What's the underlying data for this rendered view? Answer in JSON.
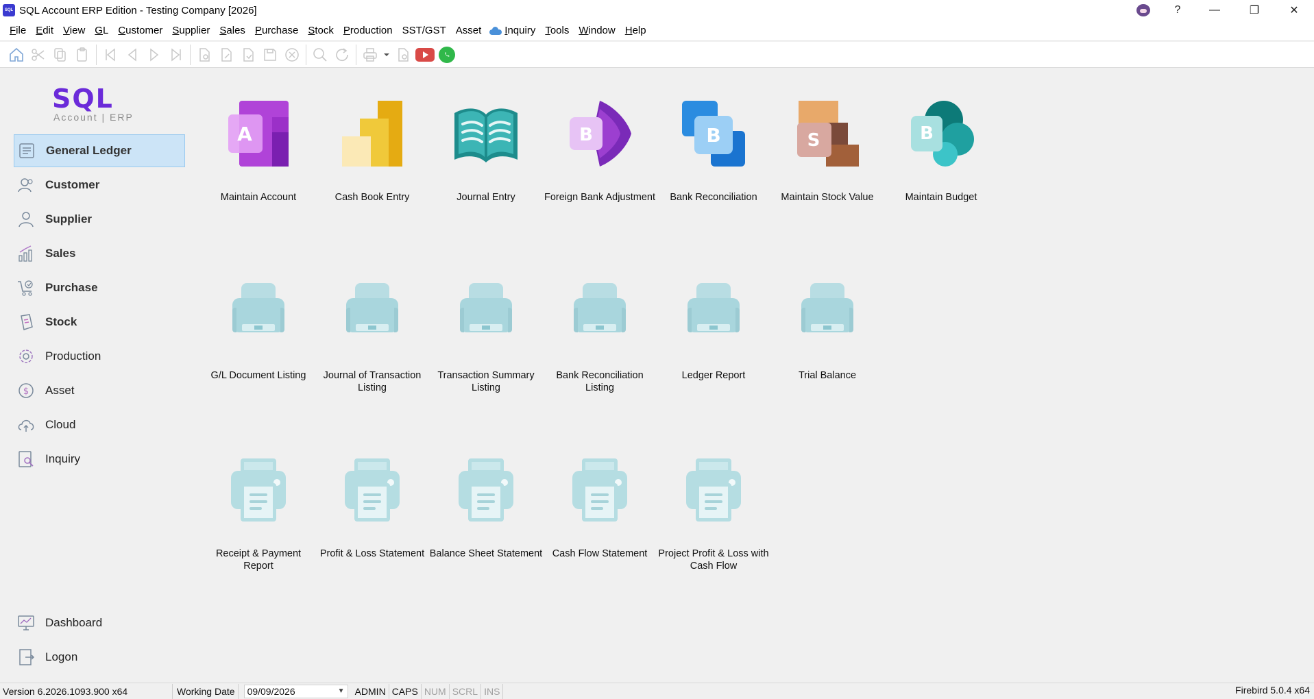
{
  "window": {
    "title": "SQL Account ERP Edition - Testing Company [2026]",
    "logo_text": "SQL",
    "help_label": "?",
    "minimize_label": "—",
    "maximize_label": "❐",
    "close_label": "✕"
  },
  "menu": [
    {
      "label": "File",
      "accel": "F",
      "rest": "ile"
    },
    {
      "label": "Edit",
      "accel": "E",
      "rest": "dit"
    },
    {
      "label": "View",
      "accel": "V",
      "rest": "iew"
    },
    {
      "label": "GL",
      "accel": "G",
      "rest": "L"
    },
    {
      "label": "Customer",
      "accel": "C",
      "rest": "ustomer"
    },
    {
      "label": "Supplier",
      "accel": "S",
      "rest": "upplier"
    },
    {
      "label": "Sales",
      "accel": "S",
      "rest": "ales"
    },
    {
      "label": "Purchase",
      "accel": "P",
      "rest": "urchase"
    },
    {
      "label": "Stock",
      "accel": "S",
      "rest": "tock"
    },
    {
      "label": "Production",
      "accel": "P",
      "rest": "roduction"
    },
    {
      "label": "SST/GST",
      "accel": "",
      "rest": "SST/GST"
    },
    {
      "label": "Asset",
      "accel": "",
      "rest": "Asset"
    },
    {
      "label": "Inquiry",
      "accel": "I",
      "rest": "nquiry"
    },
    {
      "label": "Tools",
      "accel": "T",
      "rest": "ools"
    },
    {
      "label": "Window",
      "accel": "W",
      "rest": "indow"
    },
    {
      "label": "Help",
      "accel": "H",
      "rest": "elp"
    }
  ],
  "brand": {
    "main": "SQL",
    "sub": "Account | ERP"
  },
  "sidebar": {
    "items": [
      {
        "label": "General Ledger",
        "icon": "ledger-icon",
        "active": true
      },
      {
        "label": "Customer",
        "icon": "customer-icon"
      },
      {
        "label": "Supplier",
        "icon": "supplier-icon"
      },
      {
        "label": "Sales",
        "icon": "sales-chart-icon"
      },
      {
        "label": "Purchase",
        "icon": "cart-icon"
      },
      {
        "label": "Stock",
        "icon": "stock-clipboard-icon"
      },
      {
        "label": "Production",
        "icon": "production-gear-icon"
      },
      {
        "label": "Asset",
        "icon": "asset-dollar-icon"
      },
      {
        "label": "Cloud",
        "icon": "cloud-upload-icon"
      },
      {
        "label": "Inquiry",
        "icon": "inquiry-search-icon"
      }
    ],
    "bottom": [
      {
        "label": "Dashboard",
        "icon": "dashboard-monitor-icon"
      },
      {
        "label": "Logon",
        "icon": "logon-door-icon"
      }
    ]
  },
  "tiles_row1": [
    {
      "label": "Maintain Account",
      "letter": "A"
    },
    {
      "label": "Cash Book Entry"
    },
    {
      "label": "Journal Entry"
    },
    {
      "label": "Foreign Bank Adjustment",
      "letter": "B"
    },
    {
      "label": "Bank Reconciliation",
      "letter": "B"
    },
    {
      "label": "Maintain Stock Value",
      "letter": "S"
    },
    {
      "label": "Maintain Budget",
      "letter": "B"
    }
  ],
  "tiles_row2": [
    {
      "label": "G/L Document Listing"
    },
    {
      "label": "Journal of Transaction Listing"
    },
    {
      "label": "Transaction Summary Listing"
    },
    {
      "label": "Bank Reconciliation Listing"
    },
    {
      "label": "Ledger Report"
    },
    {
      "label": "Trial Balance"
    }
  ],
  "tiles_row3": [
    {
      "label": "Receipt & Payment Report"
    },
    {
      "label": "Profit & Loss Statement"
    },
    {
      "label": "Balance Sheet Statement"
    },
    {
      "label": "Cash Flow Statement"
    },
    {
      "label": "Project Profit & Loss with Cash Flow"
    }
  ],
  "status": {
    "version": "Version 6.2026.1093.900 x64",
    "working_date_label": "Working Date",
    "working_date": "09/09/2026",
    "user": "ADMIN",
    "caps": "CAPS",
    "num": "NUM",
    "scrl": "SCRL",
    "ins": "INS",
    "db": "Firebird 5.0.4 x64"
  },
  "colors": {
    "active_nav_bg": "#cce4f7",
    "brand_purple": "#6b2bd9",
    "youtube_red": "#d94a47",
    "whatsapp_green": "#30b84a"
  }
}
